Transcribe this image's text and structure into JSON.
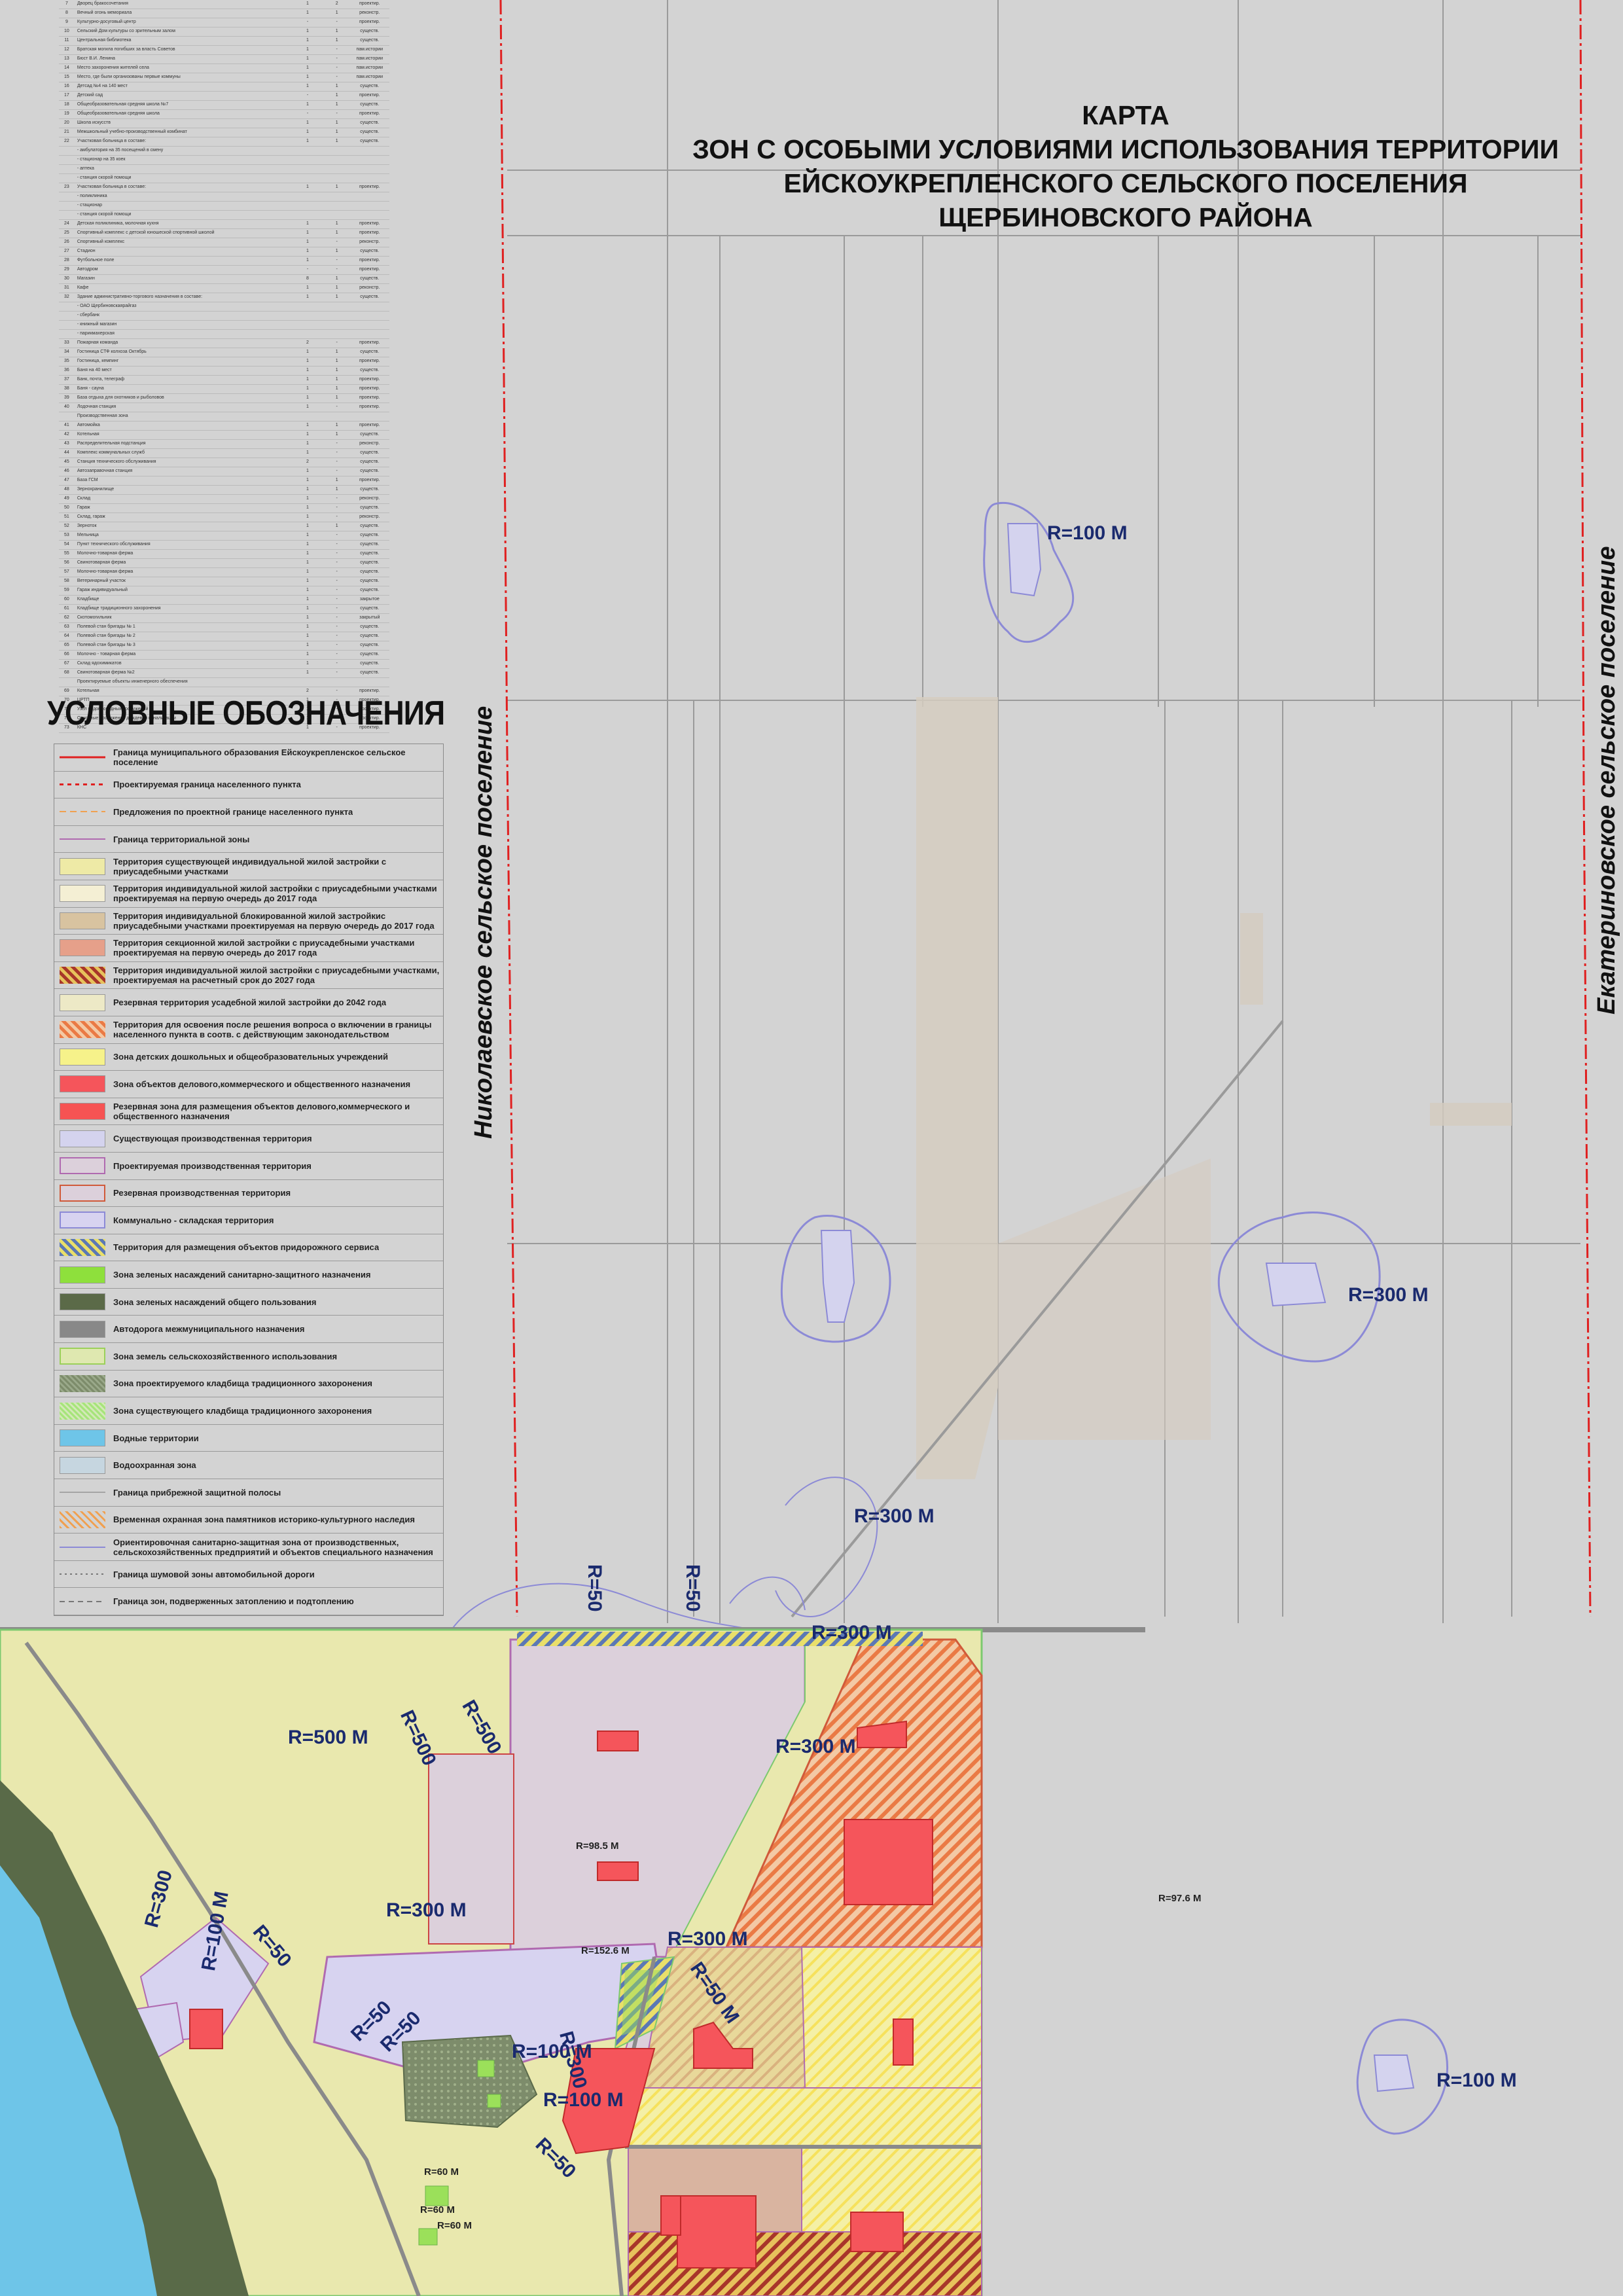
{
  "map": {
    "title_lines": [
      "КАРТА",
      "ЗОН С ОСОБЫМИ УСЛОВИЯМИ ИСПОЛЬЗОВАНИЯ ТЕРРИТОРИИ",
      "ЕЙСКОУКРЕПЛЕНСКОГО СЕЛЬСКОГО ПОСЕЛЕНИЯ",
      "ЩЕРБИНОВСКОГО РАЙОНА"
    ],
    "left_settlement": "Николаевское сельское поселение",
    "right_settlement": "Екатериновское сельское поселение"
  },
  "legend": {
    "title": "УСЛОВНЫЕ ОБОЗНАЧЕНИЯ",
    "items": [
      {
        "text": "Граница муниципального образования Ейскоукрепленское сельское поселение",
        "symbol": "line-red-dash"
      },
      {
        "text": "Проектируемая граница населенного пункта",
        "symbol": "line-red-dot"
      },
      {
        "text": "Предложения по проектной границе населенного пункта",
        "symbol": "line-orange-dash"
      },
      {
        "text": "Граница территориальной зоны",
        "symbol": "line-purple"
      },
      {
        "text": "Территория существующей индивидуальной жилой застройки с приусадебными участками",
        "symbol": "fill-yellowish"
      },
      {
        "text": "Территория индивидуальной жилой застройки с приусадебными участками проектируемая на первую очередь до 2017 года",
        "symbol": "fill-cream"
      },
      {
        "text": "Территория индивидуальной блокированной жилой застройкис приусадебными участками проектируемая на первую очередь до 2017 года",
        "symbol": "fill-tan"
      },
      {
        "text": "Территория секционной жилой застройки с приусадебными участками проектируемая на первую очередь до 2017 года",
        "symbol": "fill-salmon"
      },
      {
        "text": "Территория индивидуальной жилой застройки с приусадебными участками, проектируемая на расчетный срок до 2027 года",
        "symbol": "hatch-red-yellow"
      },
      {
        "text": "Резервная территория усадебной жилой застройки до 2042 года",
        "symbol": "fill-pale"
      },
      {
        "text": "Территория для освоения после решения вопроса о включении в границы населенного пункта в соотв. с действующим законодательством",
        "symbol": "hatch-orange"
      },
      {
        "text": "Зона детских дошкольных и общеобразовательных учреждений",
        "symbol": "fill-yellow"
      },
      {
        "text": "Зона объектов делового,коммерческого и общественного назначения",
        "symbol": "fill-red"
      },
      {
        "text": "Резервная зона для размещения объектов делового,коммерческого и общественного назначения",
        "symbol": "fill-red2"
      },
      {
        "text": "Существующая производственная территория",
        "symbol": "fill-lavender"
      },
      {
        "text": "Проектируемая производственная территория",
        "symbol": "fill-pinkgrey"
      },
      {
        "text": "Резервная производственная территория",
        "symbol": "fill-pinkgrey-red"
      },
      {
        "text": "Коммунально - складская территория",
        "symbol": "fill-lavender2"
      },
      {
        "text": "Территория для размещения объектов придорожного сервиса",
        "symbol": "hatch-blue-yellow"
      },
      {
        "text": "Зона зеленых насаждений санитарно-защитного назначения",
        "symbol": "fill-green"
      },
      {
        "text": "Зона зеленых насаждений общего пользования",
        "symbol": "fill-darkgreen"
      },
      {
        "text": "Автодорога межмуниципального назначения",
        "symbol": "fill-grey"
      },
      {
        "text": "Зона земель сельскохозяйственного использования",
        "symbol": "fill-agri"
      },
      {
        "text": "Зона проектируемого кладбища традиционного захоронения",
        "symbol": "fill-cemetery-proj"
      },
      {
        "text": "Зона существующего кладбища традиционного захоронения",
        "symbol": "fill-cemetery"
      },
      {
        "text": "Водные территории",
        "symbol": "fill-water"
      },
      {
        "text": "Водоохранная зона",
        "symbol": "fill-waterzone"
      },
      {
        "text": "Граница прибрежной защитной полосы",
        "symbol": "line-thin"
      },
      {
        "text": "Временная охранная зона памятников историко-культурного наследия",
        "symbol": "hatch-small-orange"
      },
      {
        "text": "Ориентировочная санитарно-защитная зона от производственных, сельскохозяйственных предприятий и объектов специального назначения",
        "symbol": "line-blue"
      },
      {
        "text": "Граница шумовой зоны автомобильной дороги",
        "symbol": "line-dot-grey"
      },
      {
        "text": "Граница зон, подверженных затоплению и подтоплению",
        "symbol": "line-dash-grey"
      }
    ]
  },
  "zone_labels": [
    {
      "text": "R=100 M"
    },
    {
      "text": "R=100 M"
    },
    {
      "text": "R=300 M"
    },
    {
      "text": "R=300 M"
    },
    {
      "text": "R=50"
    },
    {
      "text": "R=50"
    },
    {
      "text": "R=300 M"
    },
    {
      "text": "R=500 M"
    },
    {
      "text": "R=500"
    },
    {
      "text": "R=500"
    },
    {
      "text": "R=300 M"
    },
    {
      "text": "R=300 M"
    },
    {
      "text": "R=300"
    },
    {
      "text": "R=300 M"
    },
    {
      "text": "R=50 M"
    },
    {
      "text": "R=50"
    },
    {
      "text": "R=100 M"
    },
    {
      "text": "R=100 M"
    },
    {
      "text": "R=50"
    },
    {
      "text": "R=50"
    },
    {
      "text": "R=300"
    },
    {
      "text": "R=50"
    },
    {
      "text": "R=100 M"
    }
  ],
  "small_labels": [
    {
      "text": "R=98.5 M"
    },
    {
      "text": "R=152.6 M"
    },
    {
      "text": "R=97.6 M"
    },
    {
      "text": "R=60 M"
    },
    {
      "text": "R=60 M"
    },
    {
      "text": "R=60 M"
    }
  ],
  "objects_table": {
    "rows": [
      {
        "n": "7",
        "name": "Дворец бракосочетания",
        "q": "1",
        "q2": "2",
        "st": "проектир."
      },
      {
        "n": "8",
        "name": "Вечный огонь мемориала",
        "q": "1",
        "q2": "1",
        "st": "реконстр."
      },
      {
        "n": "9",
        "name": "Культурно-досуговый центр",
        "q": "-",
        "q2": "-",
        "st": "проектир."
      },
      {
        "n": "10",
        "name": "Сельский Дом культуры со зрительным залом",
        "q": "1",
        "q2": "1",
        "st": "существ."
      },
      {
        "n": "11",
        "name": "Центральная библиотека",
        "q": "1",
        "q2": "1",
        "st": "существ."
      },
      {
        "n": "12",
        "name": "Братская могила погибших за власть Советов",
        "q": "1",
        "q2": "-",
        "st": "пам.истории"
      },
      {
        "n": "13",
        "name": "Бюст В.И. Ленина",
        "q": "1",
        "q2": "-",
        "st": "пам.истории"
      },
      {
        "n": "14",
        "name": "Место захоронения жителей села",
        "q": "1",
        "q2": "-",
        "st": "пам.истории"
      },
      {
        "n": "15",
        "name": "Место, где были организованы первые коммуны",
        "q": "1",
        "q2": "-",
        "st": "пам.истории"
      },
      {
        "n": "16",
        "name": "Детсад №4 на 140 мест",
        "q": "1",
        "q2": "1",
        "st": "существ."
      },
      {
        "n": "17",
        "name": "Детский сад",
        "q": "-",
        "q2": "1",
        "st": "проектир."
      },
      {
        "n": "18",
        "name": "Общеобразовательная средняя школа №7",
        "q": "1",
        "q2": "1",
        "st": "существ."
      },
      {
        "n": "19",
        "name": "Общеобразовательная средняя школа",
        "q": "-",
        "q2": "-",
        "st": "проектир."
      },
      {
        "n": "20",
        "name": "Школа искусств",
        "q": "1",
        "q2": "1",
        "st": "существ."
      },
      {
        "n": "21",
        "name": "Межшкольный учебно-производственный комбинат",
        "q": "1",
        "q2": "1",
        "st": "существ."
      },
      {
        "n": "22",
        "name": "Участковая больница в составе:",
        "q": "1",
        "q2": "1",
        "st": "существ."
      },
      {
        "n": "",
        "name": " - амбулатория на 35 посещений в смену",
        "q": "",
        "q2": "",
        "st": ""
      },
      {
        "n": "",
        "name": " - стационар на 35 коек",
        "q": "",
        "q2": "",
        "st": ""
      },
      {
        "n": "",
        "name": " - аптека",
        "q": "",
        "q2": "",
        "st": ""
      },
      {
        "n": "",
        "name": " - станция скорой помощи",
        "q": "",
        "q2": "",
        "st": ""
      },
      {
        "n": "23",
        "name": "Участковая больница в составе:",
        "q": "1",
        "q2": "1",
        "st": "проектир."
      },
      {
        "n": "",
        "name": " - поликлиника",
        "q": "",
        "q2": "",
        "st": ""
      },
      {
        "n": "",
        "name": " - стационар",
        "q": "",
        "q2": "",
        "st": ""
      },
      {
        "n": "",
        "name": " - станция скорой помощи",
        "q": "",
        "q2": "",
        "st": ""
      },
      {
        "n": "24",
        "name": "Детская поликлиника, молочная кухня",
        "q": "1",
        "q2": "1",
        "st": "проектир."
      },
      {
        "n": "25",
        "name": "Спортивный комплекс с детской юношеской спортивной школой",
        "q": "1",
        "q2": "1",
        "st": "проектир."
      },
      {
        "n": "26",
        "name": "Спортивный комплекс",
        "q": "1",
        "q2": "-",
        "st": "реконстр."
      },
      {
        "n": "27",
        "name": "Стадион",
        "q": "1",
        "q2": "1",
        "st": "существ."
      },
      {
        "n": "28",
        "name": "Футбольное поле",
        "q": "1",
        "q2": "-",
        "st": "проектир."
      },
      {
        "n": "29",
        "name": "Автодром",
        "q": "-",
        "q2": "-",
        "st": "проектир."
      },
      {
        "n": "30",
        "name": "Магазин",
        "q": "8",
        "q2": "1",
        "st": "существ."
      },
      {
        "n": "31",
        "name": "Кафе",
        "q": "1",
        "q2": "1",
        "st": "реконстр."
      },
      {
        "n": "32",
        "name": "Здание административно-торгового назначения в составе:",
        "q": "1",
        "q2": "1",
        "st": "существ."
      },
      {
        "n": "",
        "name": " - ОАО Щербиновскаярайгаз",
        "q": "",
        "q2": "",
        "st": ""
      },
      {
        "n": "",
        "name": " - сбербанк",
        "q": "",
        "q2": "",
        "st": ""
      },
      {
        "n": "",
        "name": " - книжный магазин",
        "q": "",
        "q2": "",
        "st": ""
      },
      {
        "n": "",
        "name": " - парикмахерская",
        "q": "",
        "q2": "",
        "st": ""
      },
      {
        "n": "33",
        "name": "Пожарная команда",
        "q": "2",
        "q2": "-",
        "st": "проектир."
      },
      {
        "n": "34",
        "name": "Гостиница СТФ колхоза Октябрь",
        "q": "1",
        "q2": "1",
        "st": "существ."
      },
      {
        "n": "35",
        "name": "Гостиница, кемпинг",
        "q": "1",
        "q2": "1",
        "st": "проектир."
      },
      {
        "n": "36",
        "name": "Баня на 40 мест",
        "q": "1",
        "q2": "1",
        "st": "существ."
      },
      {
        "n": "37",
        "name": "Банк, почта, телеграф",
        "q": "1",
        "q2": "1",
        "st": "проектир."
      },
      {
        "n": "38",
        "name": "Баня - сауна",
        "q": "1",
        "q2": "1",
        "st": "проектир."
      },
      {
        "n": "39",
        "name": "База отдыха для охотников и рыболовов",
        "q": "1",
        "q2": "1",
        "st": "проектир."
      },
      {
        "n": "40",
        "name": "Лодочная станция",
        "q": "1",
        "q2": "-",
        "st": "проектир."
      },
      {
        "n": "",
        "name": "Производственная зона",
        "q": "",
        "q2": "",
        "st": ""
      },
      {
        "n": "41",
        "name": "Автомойка",
        "q": "1",
        "q2": "1",
        "st": "проектир."
      },
      {
        "n": "42",
        "name": "Котельная",
        "q": "1",
        "q2": "1",
        "st": "существ."
      },
      {
        "n": "43",
        "name": "Распределительная подстанция",
        "q": "1",
        "q2": "-",
        "st": "реконстр."
      },
      {
        "n": "44",
        "name": "Комплекс коммунальных служб",
        "q": "1",
        "q2": "-",
        "st": "существ."
      },
      {
        "n": "45",
        "name": "Станция технического обслуживания",
        "q": "2",
        "q2": "-",
        "st": "существ."
      },
      {
        "n": "46",
        "name": "Автозаправочная станция",
        "q": "1",
        "q2": "-",
        "st": "существ."
      },
      {
        "n": "47",
        "name": "База ГСМ",
        "q": "1",
        "q2": "1",
        "st": "проектир."
      },
      {
        "n": "48",
        "name": "Зернохранилище",
        "q": "1",
        "q2": "1",
        "st": "существ."
      },
      {
        "n": "49",
        "name": "Склад",
        "q": "1",
        "q2": "-",
        "st": "реконстр."
      },
      {
        "n": "50",
        "name": "Гараж",
        "q": "1",
        "q2": "-",
        "st": "существ."
      },
      {
        "n": "51",
        "name": "Склад, гараж",
        "q": "1",
        "q2": "-",
        "st": "реконстр."
      },
      {
        "n": "52",
        "name": "Зерноток",
        "q": "1",
        "q2": "1",
        "st": "существ."
      },
      {
        "n": "53",
        "name": "Мельница",
        "q": "1",
        "q2": "-",
        "st": "существ."
      },
      {
        "n": "54",
        "name": "Пункт технического обслуживания",
        "q": "1",
        "q2": "-",
        "st": "существ."
      },
      {
        "n": "55",
        "name": "Молочно-товарная ферма",
        "q": "1",
        "q2": "-",
        "st": "существ."
      },
      {
        "n": "56",
        "name": "Свинотоварная ферма",
        "q": "1",
        "q2": "-",
        "st": "существ."
      },
      {
        "n": "57",
        "name": "Молочно-товарная ферма",
        "q": "1",
        "q2": "-",
        "st": "существ."
      },
      {
        "n": "58",
        "name": "Ветеринарный участок",
        "q": "1",
        "q2": "-",
        "st": "существ."
      },
      {
        "n": "59",
        "name": "Гараж индивидуальный",
        "q": "1",
        "q2": "-",
        "st": "существ."
      },
      {
        "n": "60",
        "name": "Кладбище",
        "q": "1",
        "q2": "-",
        "st": "закрытое"
      },
      {
        "n": "61",
        "name": "Кладбище традиционного захоронения",
        "q": "1",
        "q2": "-",
        "st": "существ."
      },
      {
        "n": "62",
        "name": "Скотомогильник",
        "q": "1",
        "q2": "-",
        "st": "закрытый"
      },
      {
        "n": "63",
        "name": "Полевой стан бригады № 1",
        "q": "1",
        "q2": "-",
        "st": "существ."
      },
      {
        "n": "64",
        "name": "Полевой стан бригады № 2",
        "q": "1",
        "q2": "-",
        "st": "существ."
      },
      {
        "n": "65",
        "name": "Полевой стан бригады № 3",
        "q": "1",
        "q2": "-",
        "st": "существ."
      },
      {
        "n": "66",
        "name": "Молочно - товарная ферма",
        "q": "1",
        "q2": "-",
        "st": "существ."
      },
      {
        "n": "67",
        "name": "Склад ядохимикатов",
        "q": "1",
        "q2": "-",
        "st": "существ."
      },
      {
        "n": "68",
        "name": "Свинотоварная ферма №2",
        "q": "1",
        "q2": "-",
        "st": "существ."
      },
      {
        "n": "",
        "name": "Проектируемые объекты инженерного обеспечения",
        "q": "",
        "q2": "",
        "st": ""
      },
      {
        "n": "69",
        "name": "Котельная",
        "q": "2",
        "q2": "-",
        "st": "проектир."
      },
      {
        "n": "70",
        "name": "ЦРТП",
        "q": "1",
        "q2": "-",
        "st": "проектир."
      },
      {
        "n": "71",
        "name": "Узел водопроводных сооружений",
        "q": "1",
        "q2": "-",
        "st": "проектир."
      },
      {
        "n": "72",
        "name": "Очистные сооружения дождевой канализации",
        "q": "1",
        "q2": "-",
        "st": "проектир."
      },
      {
        "n": "73",
        "name": "КНС",
        "q": "1",
        "q2": "-",
        "st": "проектир."
      }
    ]
  },
  "colors": {
    "background": "#d3d3d3",
    "boundary": "#e02020",
    "residential": "#eeeaa6",
    "industrial": "#d7d3f0",
    "commercial": "#f5555b",
    "green_dark": "#5b6a4a",
    "water": "#6ec5e8",
    "label": "#1a2a6e"
  }
}
